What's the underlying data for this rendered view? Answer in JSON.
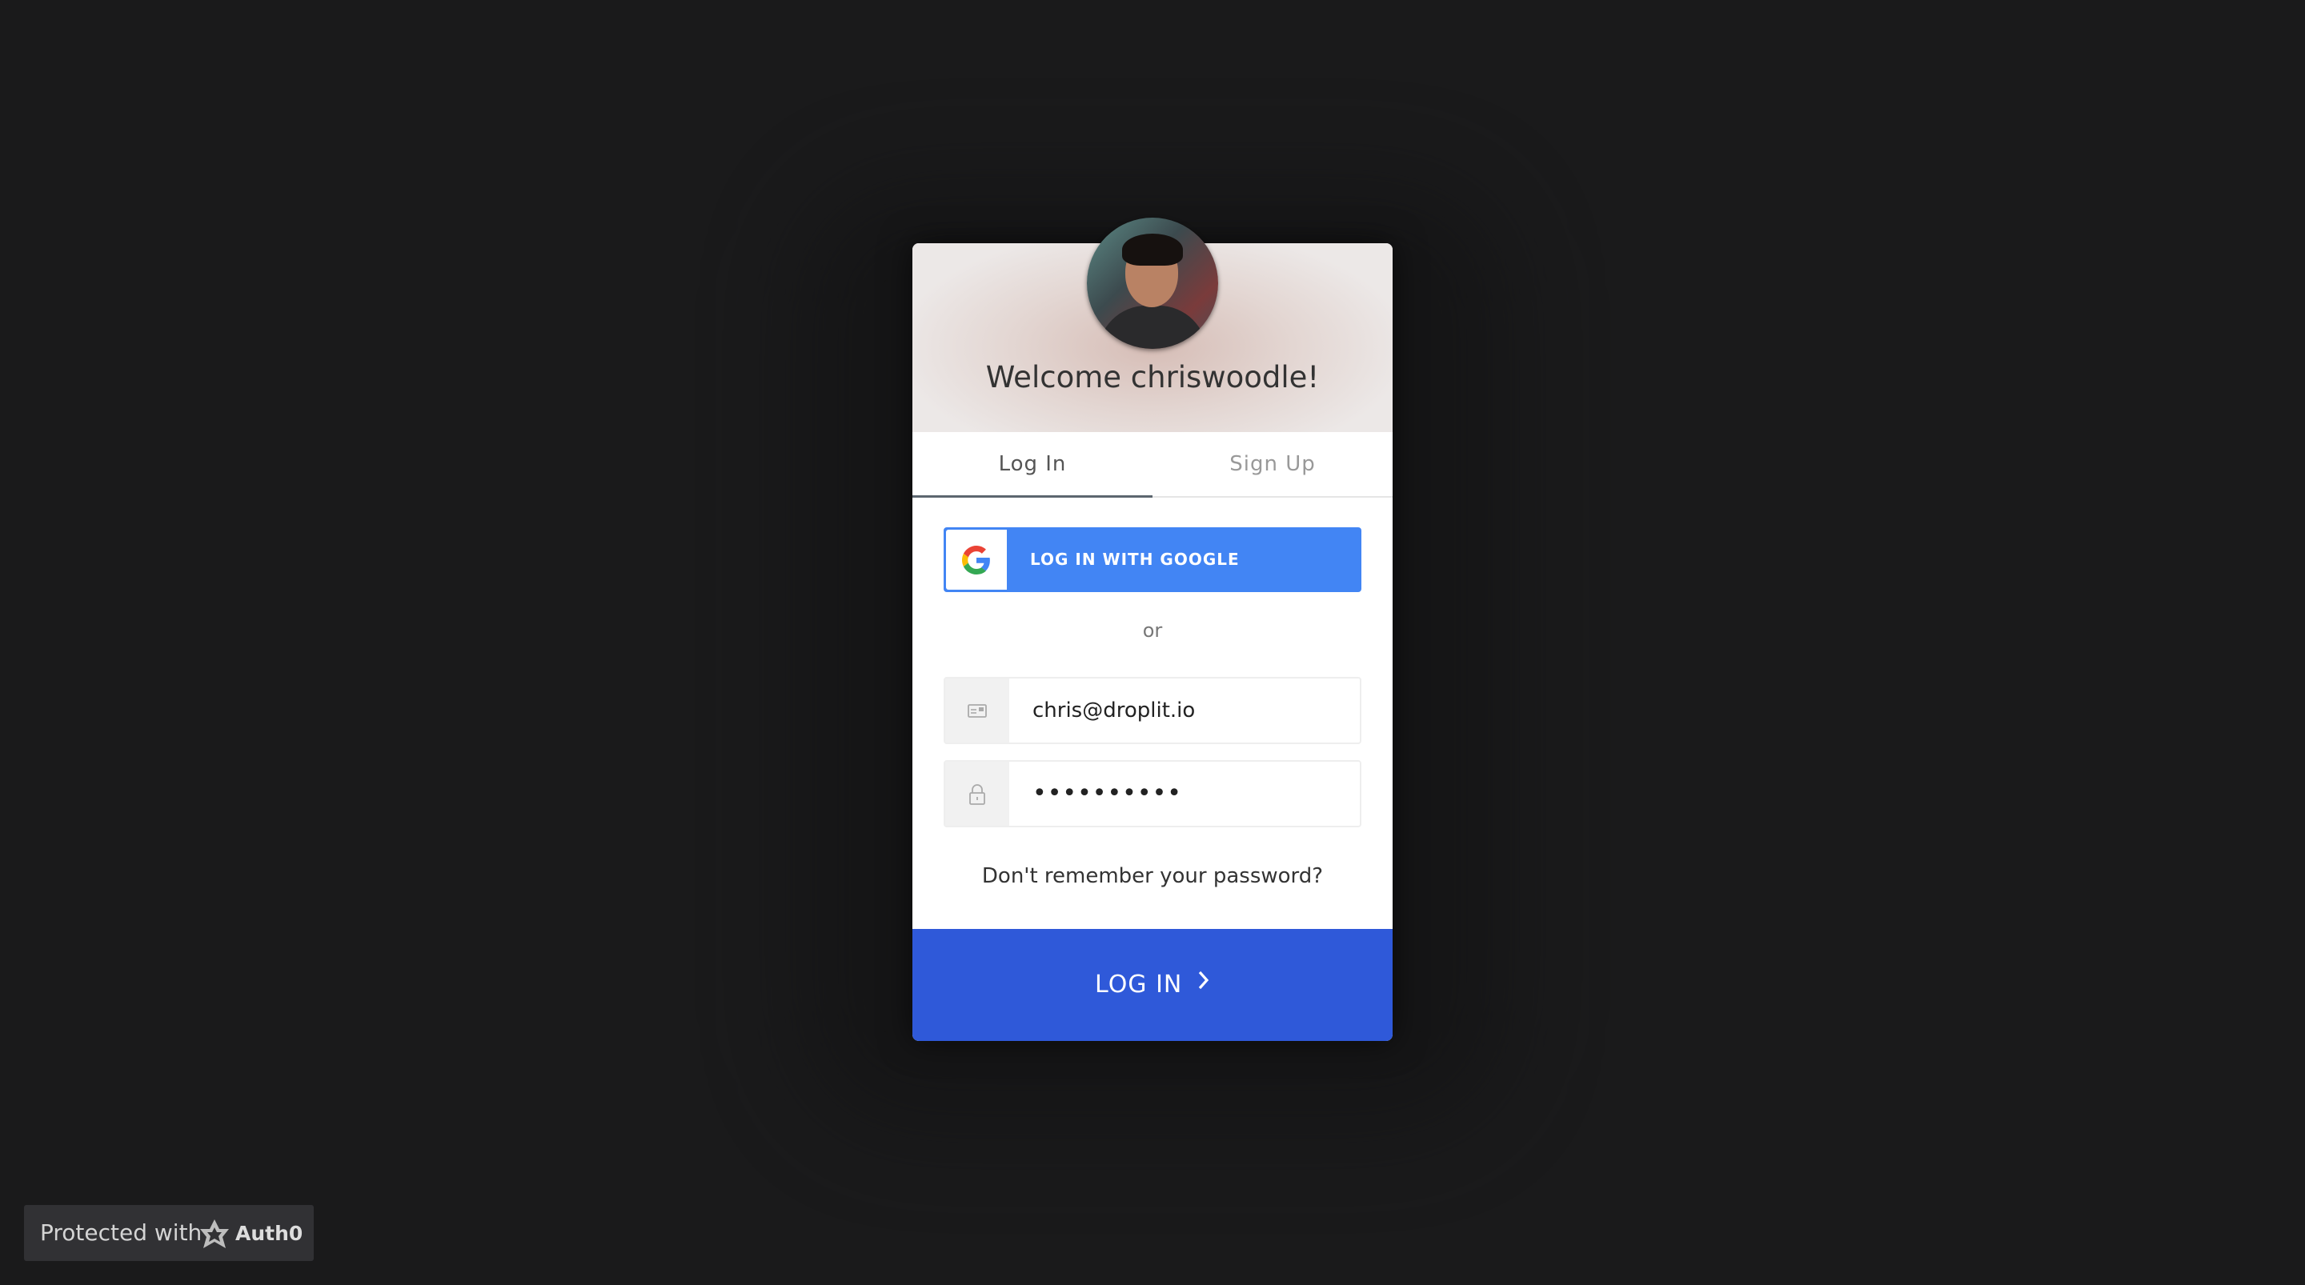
{
  "lock": {
    "welcome_text": "Welcome chriswoodle!",
    "avatar_alt": "user avatar"
  },
  "tabs": [
    {
      "label": "Log In",
      "active": true
    },
    {
      "label": "Sign Up",
      "active": false
    }
  ],
  "social": {
    "google_label": "LOG IN WITH GOOGLE",
    "google_icon": "google-g-icon",
    "google_color": "#4285f4"
  },
  "separator": "or",
  "form": {
    "email": {
      "value": "chris@droplit.io",
      "icon": "envelope-icon"
    },
    "password": {
      "value": "••••••••••",
      "icon": "lock-icon"
    }
  },
  "forgot_password": "Don't remember your password?",
  "submit": {
    "label": "LOG IN",
    "icon": "chevron-right-icon",
    "color": "#2f59d9"
  },
  "badge": {
    "prefix": "Protected with",
    "brand": "Auth0",
    "icon": "auth0-shield-icon"
  },
  "colors": {
    "background": "#1a1a1b",
    "card": "#ffffff"
  }
}
